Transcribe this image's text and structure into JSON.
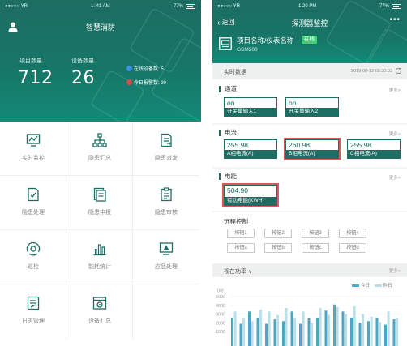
{
  "left_app": {
    "status": {
      "carrier": "●●○○○ YR",
      "time": "1: 41 AM",
      "battery": "77%"
    },
    "title": "智慧消防",
    "stats": [
      {
        "label": "项目数量",
        "value": "712"
      },
      {
        "label": "设备数量",
        "value": "26"
      }
    ],
    "side_stats": [
      {
        "label": "在线设备数: 5",
        "color": "#3f8ef0"
      },
      {
        "label": "今日报警数: 30",
        "color": "#e04848"
      }
    ],
    "menu": [
      {
        "label": "实时监控",
        "icon": "realtime-monitor-icon"
      },
      {
        "label": "隐患汇总",
        "icon": "hazard-summary-icon"
      },
      {
        "label": "隐患派发",
        "icon": "hazard-dispatch-icon"
      },
      {
        "label": "隐患处理",
        "icon": "hazard-handle-icon"
      },
      {
        "label": "隐患申报",
        "icon": "hazard-report-icon"
      },
      {
        "label": "隐患审核",
        "icon": "hazard-review-icon"
      },
      {
        "label": "巡检",
        "icon": "patrol-icon"
      },
      {
        "label": "能耗统计",
        "icon": "energy-stats-icon"
      },
      {
        "label": "应急处理",
        "icon": "emergency-icon"
      },
      {
        "label": "日志管理",
        "icon": "log-icon"
      },
      {
        "label": "设备汇总",
        "icon": "device-summary-icon"
      }
    ]
  },
  "right_app": {
    "status": {
      "carrier": "●●○○○ YR",
      "time": "1:20 PM",
      "battery": "77%"
    },
    "nav": {
      "back": "返回",
      "title": "探测器监控",
      "more": "•••"
    },
    "device": {
      "name": "项目名称/仪表名称",
      "status": "在线",
      "model": "GSM200"
    },
    "realtime": {
      "title": "实时数据",
      "time": "2019-08-12 08:30:03"
    },
    "channel": {
      "title": "通道",
      "more": "更多>",
      "items": [
        {
          "value": "on",
          "caption": "开关量输入1"
        },
        {
          "value": "on",
          "caption": "开关量输入2"
        }
      ]
    },
    "current": {
      "title": "电流",
      "more": "更多>",
      "items": [
        {
          "value": "255.98",
          "caption": "A相电流(A)",
          "alert": false
        },
        {
          "value": "260.98",
          "caption": "B相电流(A)",
          "alert": true
        },
        {
          "value": "255.98",
          "caption": "C相电流(A)",
          "alert": false
        }
      ]
    },
    "energy": {
      "title": "电能",
      "more": "更多>",
      "items": [
        {
          "value": "504.90",
          "caption": "有功电能(KWH)",
          "alert": true
        }
      ]
    },
    "remote": {
      "title": "远程控制",
      "buttons": [
        "按钮1",
        "按钮2",
        "按钮3",
        "按钮4",
        "按钮a",
        "按钮b",
        "按钮c",
        "按钮d"
      ]
    },
    "power": {
      "title": "视在功率",
      "more": "更多>"
    },
    "colors": {
      "accent": "#1d6d63",
      "today": "#4aa8c6",
      "yesterday": "#b9dfe9",
      "alert": "#e05858",
      "online": "#3fd07a"
    }
  },
  "chart_data": {
    "type": "bar",
    "ylabel": "(w)",
    "ylim": [
      0,
      5000
    ],
    "yticks": [
      "5000",
      "4000",
      "3000",
      "2000",
      "1000"
    ],
    "legend": [
      "今日",
      "昨日"
    ],
    "series": [
      {
        "name": "今日",
        "values": [
          2600,
          1900,
          3300,
          2600,
          1900,
          2400,
          2200,
          3300,
          1900,
          2500,
          2600,
          3400,
          4100,
          3300,
          2600,
          2000,
          2200,
          2600,
          1800,
          2400
        ]
      },
      {
        "name": "昨日",
        "values": [
          3300,
          2600,
          2200,
          3500,
          3300,
          2900,
          3700,
          2600,
          3300,
          2000,
          3700,
          2900,
          3800,
          3000,
          3900,
          3000,
          2700,
          2100,
          3300,
          2600
        ]
      }
    ]
  }
}
